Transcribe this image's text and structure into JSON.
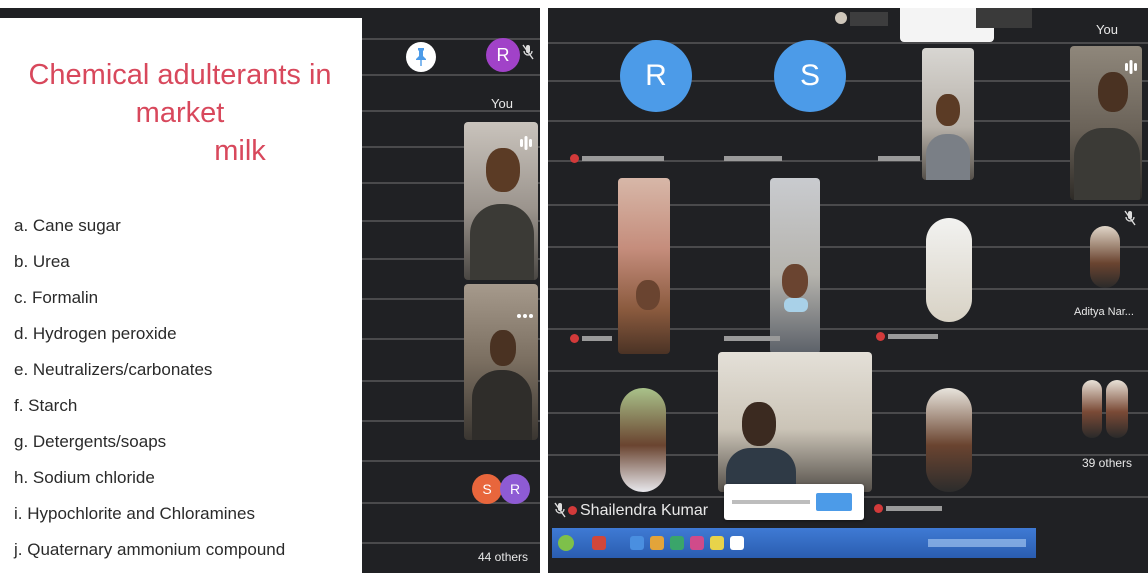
{
  "left": {
    "slide": {
      "title_line1": "Chemical adulterants in market",
      "title_line2": "milk",
      "items": [
        "a. Cane sugar",
        "b. Urea",
        "c. Formalin",
        "d. Hydrogen peroxide",
        "e. Neutralizers/carbonates",
        "f. Starch",
        "g. Detergents/soaps",
        "h. Sodium chloride",
        "i. Hypochlorite and Chloramines",
        "j. Quaternary ammonium compound"
      ]
    },
    "self_avatar_letter": "R",
    "self_label": "You",
    "group_letters": [
      "S",
      "R"
    ],
    "others_label": "44 others"
  },
  "right": {
    "tile1_letter": "R",
    "tile2_letter": "S",
    "you_label": "You",
    "aditya_label": "Aditya Nar...",
    "others_label": "39 others",
    "speaker_label": "Shailendra Kumar",
    "colors": {
      "r_circle": "#4c9be8",
      "s_circle": "#4c9be8",
      "r_self": "#a142c8",
      "s_group": "#e8663c",
      "r_group": "#8e5bd4"
    }
  }
}
